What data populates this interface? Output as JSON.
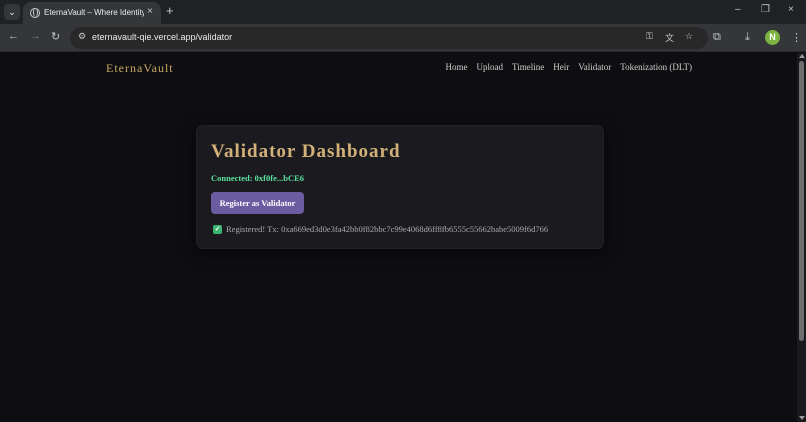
{
  "browser": {
    "tab_search_icon": "chevron-down-icon",
    "tab_title": "EternaVault – Where Identity M",
    "tab_close": "×",
    "new_tab": "+",
    "url": "eternavault-qie.vercel.app/validator",
    "profile_initial": "N",
    "window_controls": [
      "–",
      "❐",
      "×"
    ]
  },
  "site": {
    "brand": "EternaVault",
    "nav": [
      "Home",
      "Upload",
      "Timeline",
      "Heir",
      "Validator",
      "Tokenization (DLT)"
    ]
  },
  "dashboard": {
    "title": "Validator Dashboard",
    "connected": "Connected: 0xf0fe...bCE6",
    "register_button": "Register as Validator",
    "status": "Registered! Tx: 0xa669ed3d0e3fa42bb0f82bbc7c99e4068d6ff8fb6555c55662babe5009f6d766"
  },
  "colors": {
    "accent": "#c9a865",
    "button": "#6b5ba0",
    "connected": "#5ce0a0",
    "success": "#3cb371"
  }
}
